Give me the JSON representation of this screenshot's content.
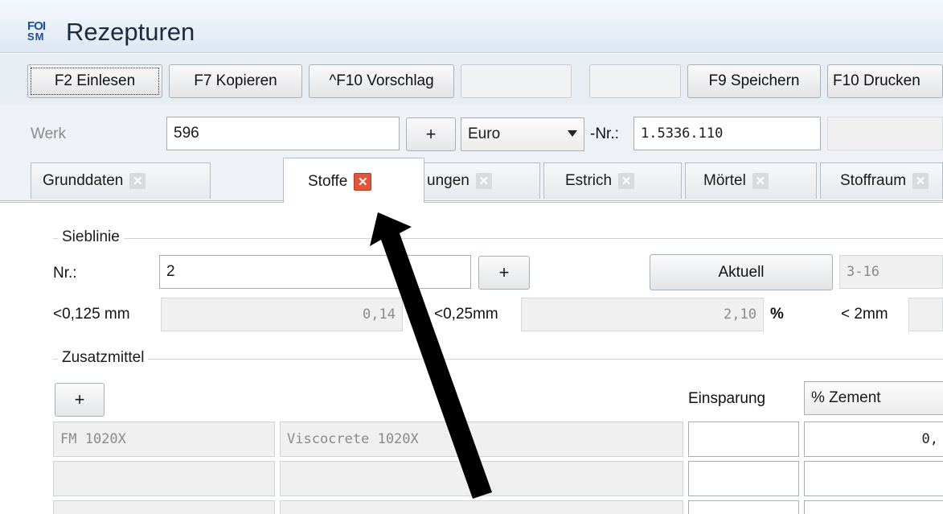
{
  "window": {
    "title": "Rezepturen",
    "logo_line1": "FOI",
    "logo_line2": "SM"
  },
  "toolbar": {
    "einlesen": "F2 Einlesen",
    "kopieren": "F7 Kopieren",
    "vorschlag": "^F10 Vorschlag",
    "speichern": "F9 Speichern",
    "drucken": "F10 Drucken"
  },
  "werk": {
    "label": "Werk",
    "value": "596",
    "plus": "+",
    "currency": "Euro",
    "nr_label": "-Nr.:",
    "nr_value": "1.5336.110"
  },
  "tabs": [
    {
      "label": "Grunddaten"
    },
    {
      "label": "Stoffe"
    },
    {
      "label": "ungen"
    },
    {
      "label": "Estrich"
    },
    {
      "label": "Mörtel"
    },
    {
      "label": "Stoffraum"
    }
  ],
  "sieblinie": {
    "legend": "Sieblinie",
    "nr_label": "Nr.:",
    "nr_value": "2",
    "plus": "+",
    "aktuell": "Aktuell",
    "range": "3-16",
    "lt0125_label": "<0,125 mm",
    "lt0125_value": "0,14",
    "lt025_label": "<0,25mm",
    "lt025_value": "2,10",
    "percent": "%",
    "lt2_label": "< 2mm"
  },
  "zusatzmittel": {
    "legend": "Zusatzmittel",
    "plus": "+",
    "einsparung_label": "Einsparung",
    "einsparung_value": "% Zement",
    "rows": [
      {
        "code": "FM 1020X",
        "name": "Viscocrete 1020X",
        "value": "0,"
      },
      {
        "code": "",
        "name": "",
        "value": ""
      },
      {
        "code": "",
        "name": "",
        "value": ""
      }
    ]
  },
  "icons": {
    "close": "close-icon",
    "dropdown": "chevron-down-icon"
  },
  "colors": {
    "close_active": "#e0553b",
    "close_inactive": "#d8dadd",
    "titlebar": "#dde7f3"
  }
}
